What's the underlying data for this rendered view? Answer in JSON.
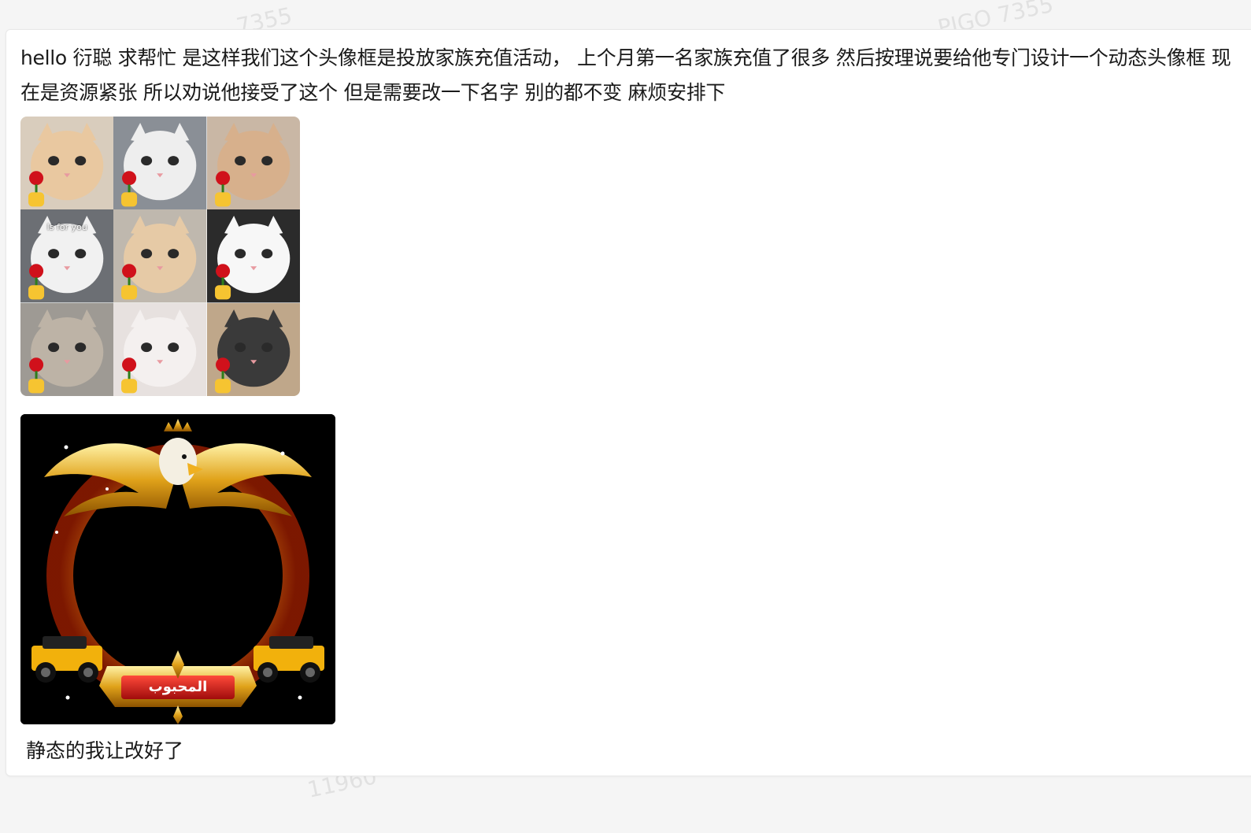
{
  "message": {
    "text": "hello 衍聪 求帮忙 是这样我们这个头像框是投放家族充值活动，  上个月第一名家族充值了很多  然后按理说要给他专门设计一个动态头像框 现在是资源紧张 所以劝说他接受了这个 但是需要改一下名字  别的都不变 麻烦安排下",
    "footer": "静态的我让改好了"
  },
  "cat_grid": {
    "caption": "Is for you",
    "cells": [
      {
        "name": "cat-cream",
        "fur": "#e9c8a0",
        "bg": "#d9cdbd"
      },
      {
        "name": "cat-ragdoll",
        "fur": "#eeeeee",
        "bg": "#8a8f96"
      },
      {
        "name": "cat-hamster",
        "fur": "#d7b08c",
        "bg": "#c9b7a5"
      },
      {
        "name": "cat-kitten",
        "fur": "#f1f1f1",
        "bg": "#6c6f74"
      },
      {
        "name": "cat-cream-2",
        "fur": "#e6caa6",
        "bg": "#bfb8ae"
      },
      {
        "name": "cat-white-black",
        "fur": "#f7f7f7",
        "bg": "#2b2b2b"
      },
      {
        "name": "cat-tabby",
        "fur": "#bdb3a6",
        "bg": "#9e9a94"
      },
      {
        "name": "cat-white",
        "fur": "#f4f0ef",
        "bg": "#e7e1df"
      },
      {
        "name": "cat-tuxedo",
        "fur": "#3a3a3a",
        "bg": "#bfa78a"
      }
    ]
  },
  "frame": {
    "banner_text": "المحبوب"
  },
  "watermarks": [
    "7355",
    "PIGO 7355",
    "11960",
    "7355"
  ]
}
